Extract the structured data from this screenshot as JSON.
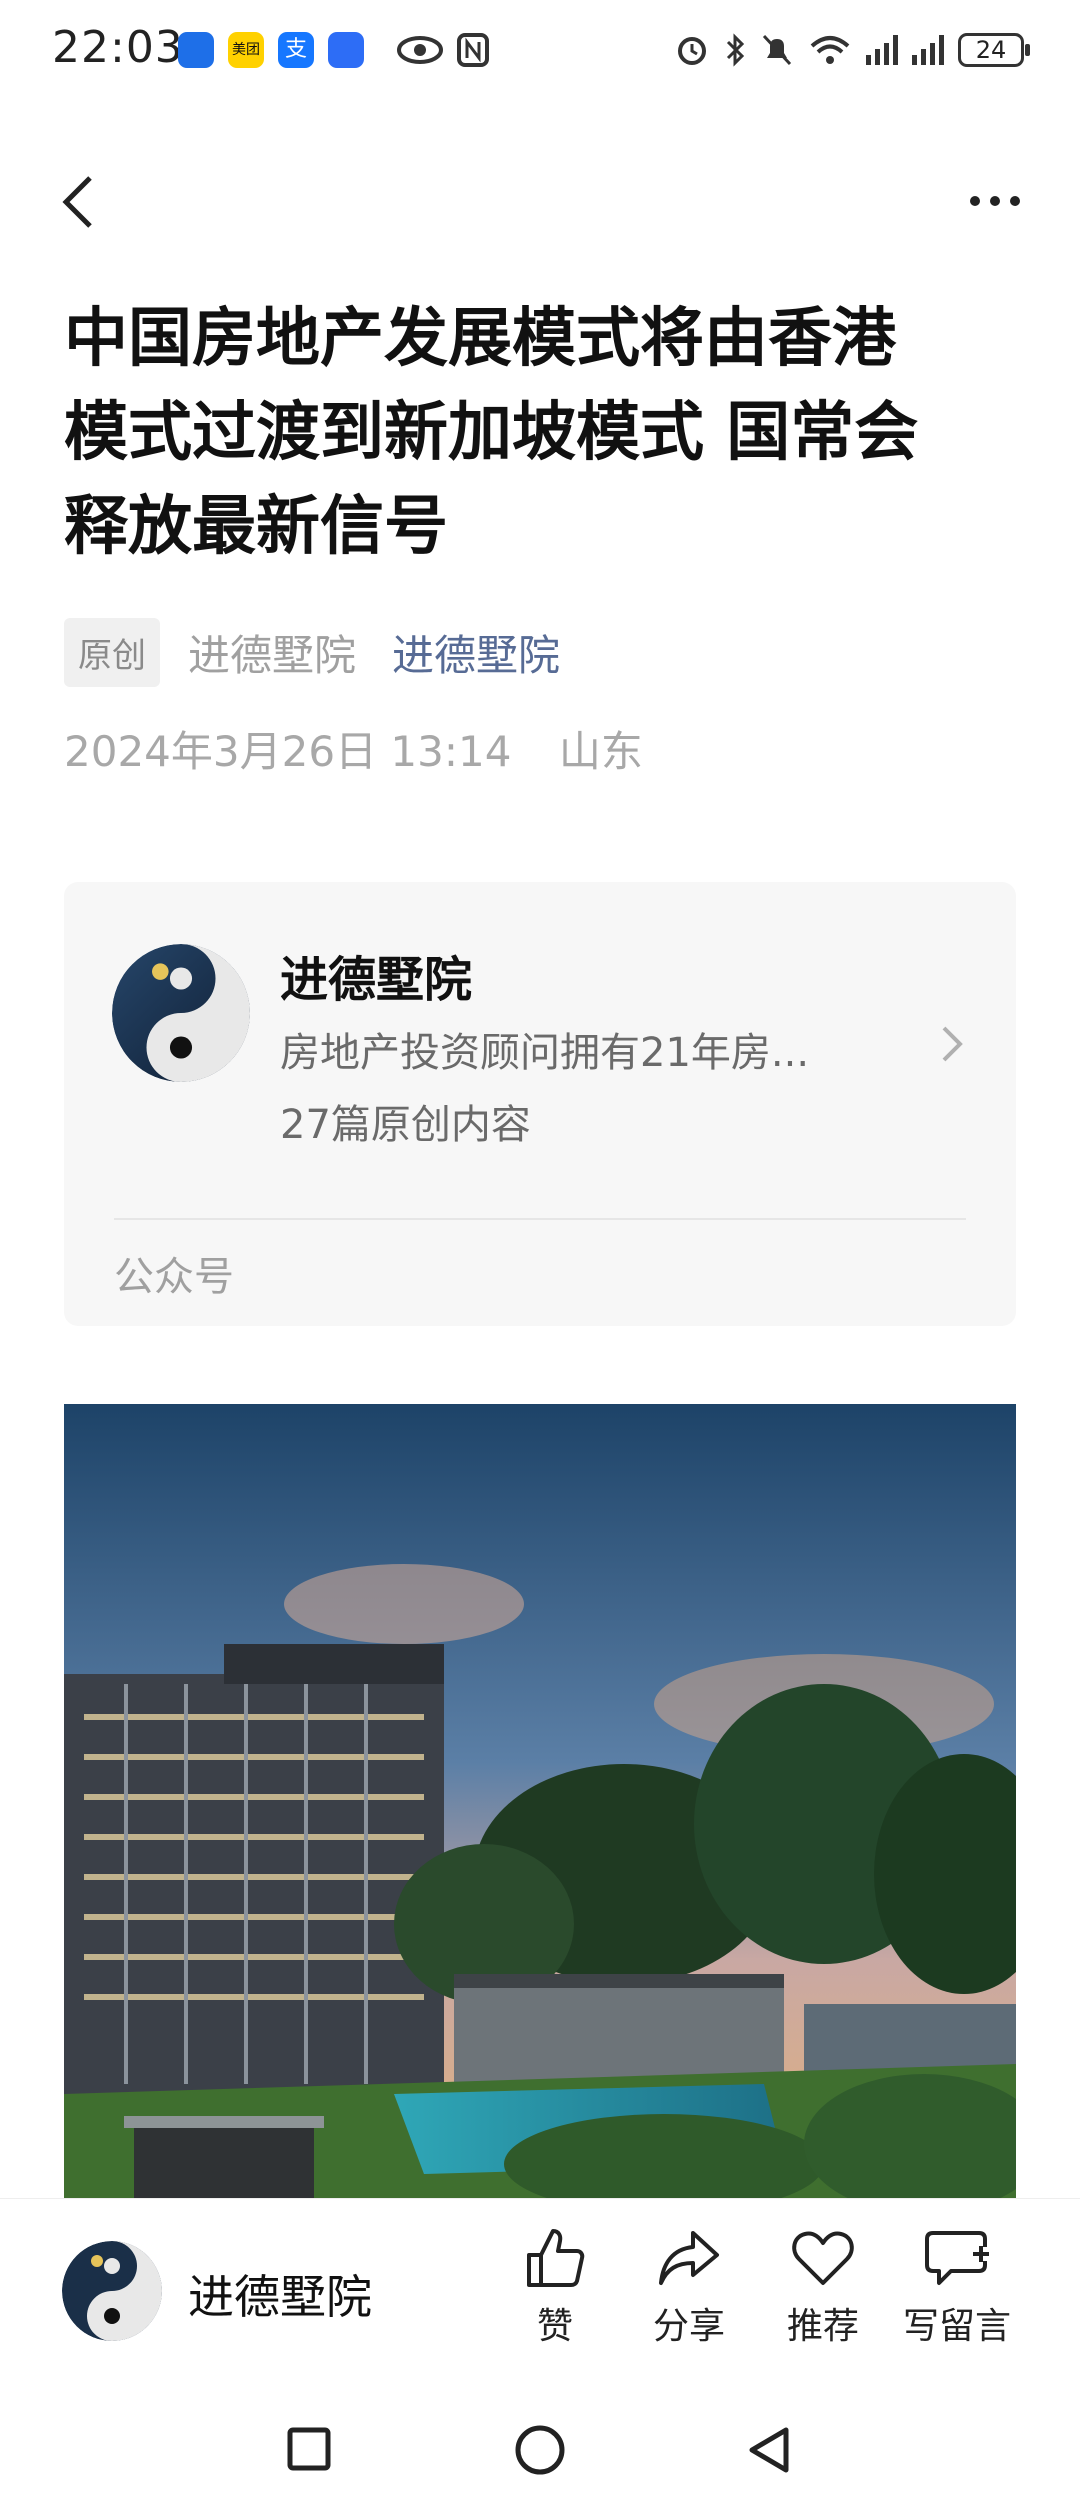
{
  "status_bar": {
    "time": "22:03",
    "apps": [
      {
        "icon": "tencent-app-icon",
        "color": "#1e6fe8"
      },
      {
        "icon": "meituan-icon",
        "color": "#ffd100",
        "text": "美团"
      },
      {
        "icon": "alipay-icon",
        "color": "#1677ff",
        "text": "支"
      },
      {
        "icon": "voice-app-icon",
        "color": "#2d6df6"
      }
    ],
    "battery": "24"
  },
  "nav": {
    "back_icon": "chevron-left-icon",
    "more_icon": "more-dots-icon"
  },
  "article": {
    "title_line1": "中国房地产发展模式将由香港",
    "title_line2": "模式过渡到新加坡模式 国常会",
    "title_line3": "释放最新信号",
    "original_tag": "原创",
    "author_gray": "进德墅院",
    "author_link": "进德墅院",
    "date": "2024年3月26日 13:14",
    "location": "山东"
  },
  "account_card": {
    "name": "进德墅院",
    "description": "房地产投资顾问拥有21年房...",
    "count": "27篇原创内容",
    "footer": "公众号"
  },
  "bottom_bar": {
    "account_name": "进德墅院",
    "actions": [
      {
        "label": "赞",
        "icon": "thumbs-up-icon"
      },
      {
        "label": "分享",
        "icon": "share-icon"
      },
      {
        "label": "推荐",
        "icon": "heart-icon"
      },
      {
        "label": "写留言",
        "icon": "comment-add-icon"
      }
    ]
  },
  "colors": {
    "link": "#576b95",
    "gray_text": "#a0a0a0",
    "card_bg": "#f7f7f7"
  }
}
